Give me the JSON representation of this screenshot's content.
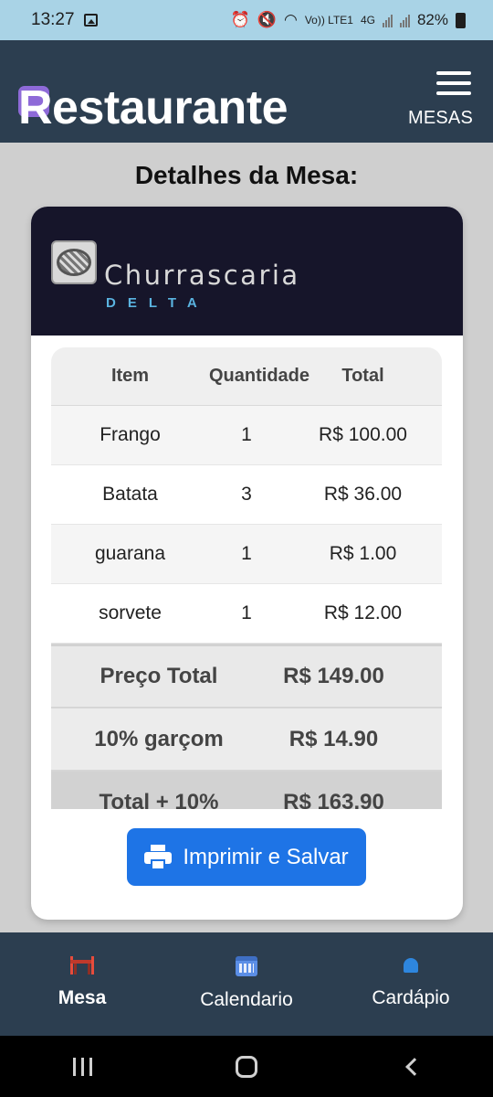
{
  "status_bar": {
    "time": "13:27",
    "network_label": "Vo)) LTE1",
    "network_4g": "4G",
    "battery": "82%"
  },
  "app_bar": {
    "title": "Restaurante",
    "mesas_link": "MESAS"
  },
  "page": {
    "title": "Detalhes da Mesa:"
  },
  "restaurant": {
    "name": "Churrascaria",
    "subtitle": "DELTA"
  },
  "order_table": {
    "columns": [
      "Item",
      "Quantidade",
      "Total"
    ],
    "rows": [
      {
        "item": "Frango",
        "qty": "1",
        "total": "R$ 100.00"
      },
      {
        "item": "Batata",
        "qty": "3",
        "total": "R$ 36.00"
      },
      {
        "item": "guarana",
        "qty": "1",
        "total": "R$ 1.00"
      },
      {
        "item": "sorvete",
        "qty": "1",
        "total": "R$ 12.00"
      }
    ],
    "summary": [
      {
        "label": "Preço Total",
        "value": "R$ 149.00"
      },
      {
        "label": "10% garçom",
        "value": "R$ 14.90"
      },
      {
        "label": "Total + 10%",
        "value": "R$ 163.90"
      }
    ]
  },
  "actions": {
    "print_save": "Imprimir e Salvar"
  },
  "bottom_nav": {
    "items": [
      {
        "label": "Mesa",
        "icon": "table-icon",
        "active": true
      },
      {
        "label": "Calendario",
        "icon": "calendar-icon",
        "active": false
      },
      {
        "label": "Cardápio",
        "icon": "bell-icon",
        "active": false
      }
    ]
  },
  "colors": {
    "app_bar": "#2c3e50",
    "primary_button": "#1e74e6",
    "card_header": "#16152a",
    "status_bar": "#a9d3e6"
  }
}
